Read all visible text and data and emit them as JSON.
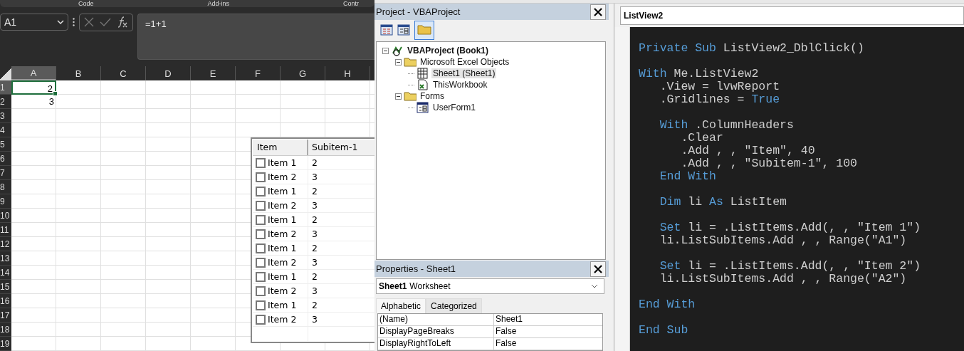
{
  "ribbon_groups": [
    "Code",
    "Add-ins",
    "Contr"
  ],
  "name_box": {
    "value": "A1"
  },
  "formula_bar": {
    "value": "=1+1"
  },
  "sheet": {
    "columns": [
      {
        "label": "A",
        "selected": true
      },
      {
        "label": "B",
        "selected": false
      },
      {
        "label": "C",
        "selected": false
      },
      {
        "label": "D",
        "selected": false
      },
      {
        "label": "E",
        "selected": false
      },
      {
        "label": "F",
        "selected": false
      },
      {
        "label": "G",
        "selected": false
      },
      {
        "label": "H",
        "selected": false
      }
    ],
    "rows": [
      {
        "label": "1",
        "selected": true,
        "cells": [
          "2"
        ]
      },
      {
        "label": "2",
        "selected": false,
        "cells": [
          "3"
        ]
      },
      {
        "label": "3",
        "selected": false,
        "cells": []
      },
      {
        "label": "4",
        "selected": false,
        "cells": []
      },
      {
        "label": "5",
        "selected": false,
        "cells": []
      },
      {
        "label": "6",
        "selected": false,
        "cells": []
      },
      {
        "label": "7",
        "selected": false,
        "cells": []
      },
      {
        "label": "8",
        "selected": false,
        "cells": []
      },
      {
        "label": "9",
        "selected": false,
        "cells": []
      },
      {
        "label": "10",
        "selected": false,
        "cells": []
      },
      {
        "label": "11",
        "selected": false,
        "cells": []
      },
      {
        "label": "12",
        "selected": false,
        "cells": []
      },
      {
        "label": "13",
        "selected": false,
        "cells": []
      },
      {
        "label": "14",
        "selected": false,
        "cells": []
      },
      {
        "label": "15",
        "selected": false,
        "cells": []
      },
      {
        "label": "16",
        "selected": false,
        "cells": []
      },
      {
        "label": "17",
        "selected": false,
        "cells": []
      },
      {
        "label": "18",
        "selected": false,
        "cells": []
      },
      {
        "label": "19",
        "selected": false,
        "cells": []
      }
    ]
  },
  "listview": {
    "columns": [
      "Item",
      "Subitem-1"
    ],
    "rows": [
      {
        "item": "Item 1",
        "subitem": "2",
        "checked": false
      },
      {
        "item": "Item 2",
        "subitem": "3",
        "checked": false
      },
      {
        "item": "Item 1",
        "subitem": "2",
        "checked": false
      },
      {
        "item": "Item 2",
        "subitem": "3",
        "checked": false
      },
      {
        "item": "Item 1",
        "subitem": "2",
        "checked": false
      },
      {
        "item": "Item 2",
        "subitem": "3",
        "checked": false
      },
      {
        "item": "Item 1",
        "subitem": "2",
        "checked": false
      },
      {
        "item": "Item 2",
        "subitem": "3",
        "checked": false
      },
      {
        "item": "Item 1",
        "subitem": "2",
        "checked": false
      },
      {
        "item": "Item 2",
        "subitem": "3",
        "checked": false
      },
      {
        "item": "Item 1",
        "subitem": "2",
        "checked": false
      },
      {
        "item": "Item 2",
        "subitem": "3",
        "checked": false
      }
    ]
  },
  "project": {
    "title": "Project - VBAProject",
    "tree": [
      {
        "label": "VBAProject (Book1)",
        "kind": "project",
        "expanded": true,
        "selected": false,
        "children": [
          {
            "label": "Microsoft Excel Objects",
            "kind": "folder",
            "expanded": true,
            "selected": false,
            "children": [
              {
                "label": "Sheet1 (Sheet1)",
                "kind": "sheet",
                "selected": true
              },
              {
                "label": "ThisWorkbook",
                "kind": "workbook",
                "selected": false
              }
            ]
          },
          {
            "label": "Forms",
            "kind": "folder",
            "expanded": true,
            "selected": false,
            "children": [
              {
                "label": "UserForm1",
                "kind": "form",
                "selected": false
              }
            ]
          }
        ]
      }
    ]
  },
  "properties": {
    "title": "Properties - Sheet1",
    "object_name": "Sheet1",
    "object_type": "Worksheet",
    "tabs": [
      {
        "label": "Alphabetic",
        "selected": true
      },
      {
        "label": "Categorized",
        "selected": false
      }
    ],
    "rows": [
      {
        "name": "(Name)",
        "value": "Sheet1"
      },
      {
        "name": "DisplayPageBreaks",
        "value": "False"
      },
      {
        "name": "DisplayRightToLeft",
        "value": "False"
      }
    ]
  },
  "code_window": {
    "object": "ListView2",
    "lines": [
      {
        "kind": "blank"
      },
      {
        "kind": "code",
        "segments": [
          {
            "kind": "keyword",
            "text": "Private Sub"
          },
          {
            "kind": "plain",
            "text": " ListView2_DblClick()"
          }
        ]
      },
      {
        "kind": "blank"
      },
      {
        "kind": "code",
        "segments": [
          {
            "kind": "keyword",
            "text": "With"
          },
          {
            "kind": "plain",
            "text": " Me.ListView2"
          }
        ]
      },
      {
        "kind": "code",
        "segments": [
          {
            "kind": "plain",
            "text": "   .View = lvwReport"
          }
        ]
      },
      {
        "kind": "code",
        "segments": [
          {
            "kind": "plain",
            "text": "   .Gridlines = "
          },
          {
            "kind": "keyword",
            "text": "True"
          }
        ]
      },
      {
        "kind": "blank"
      },
      {
        "kind": "code",
        "segments": [
          {
            "kind": "keyword",
            "text": "   With"
          },
          {
            "kind": "plain",
            "text": " .ColumnHeaders"
          }
        ]
      },
      {
        "kind": "code",
        "segments": [
          {
            "kind": "plain",
            "text": "      .Clear"
          }
        ]
      },
      {
        "kind": "code",
        "segments": [
          {
            "kind": "plain",
            "text": "      .Add , , \"Item\", 40"
          }
        ]
      },
      {
        "kind": "code",
        "segments": [
          {
            "kind": "plain",
            "text": "      .Add , , \"Subitem-1\", 100"
          }
        ]
      },
      {
        "kind": "code",
        "segments": [
          {
            "kind": "keyword",
            "text": "   End With"
          }
        ]
      },
      {
        "kind": "blank"
      },
      {
        "kind": "code",
        "segments": [
          {
            "kind": "keyword",
            "text": "   Dim"
          },
          {
            "kind": "plain",
            "text": " li "
          },
          {
            "kind": "keyword",
            "text": "As"
          },
          {
            "kind": "plain",
            "text": " ListItem"
          }
        ]
      },
      {
        "kind": "blank"
      },
      {
        "kind": "code",
        "segments": [
          {
            "kind": "keyword",
            "text": "   Set"
          },
          {
            "kind": "plain",
            "text": " li = .ListItems.Add(, , \"Item 1\")"
          }
        ]
      },
      {
        "kind": "code",
        "segments": [
          {
            "kind": "plain",
            "text": "   li.ListSubItems.Add , , Range(\"A1\")"
          }
        ]
      },
      {
        "kind": "blank"
      },
      {
        "kind": "code",
        "segments": [
          {
            "kind": "keyword",
            "text": "   Set"
          },
          {
            "kind": "plain",
            "text": " li = .ListItems.Add(, , \"Item 2\")"
          }
        ]
      },
      {
        "kind": "code",
        "segments": [
          {
            "kind": "plain",
            "text": "   li.ListSubItems.Add , , Range(\"A2\")"
          }
        ]
      },
      {
        "kind": "blank"
      },
      {
        "kind": "code",
        "segments": [
          {
            "kind": "keyword",
            "text": "End With"
          }
        ]
      },
      {
        "kind": "blank"
      },
      {
        "kind": "code",
        "segments": [
          {
            "kind": "keyword",
            "text": "End Sub"
          }
        ]
      }
    ]
  }
}
